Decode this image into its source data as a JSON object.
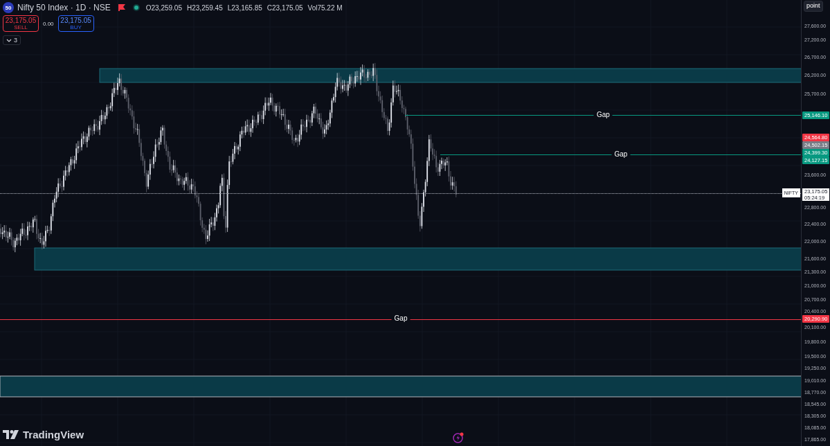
{
  "symbol": {
    "logo_text": "50",
    "title": "Nifty 50 Index · 1D · NSE",
    "flagged": true,
    "market_open": true
  },
  "ohlc": [
    {
      "label": "O",
      "value": "23,259.05"
    },
    {
      "label": "H",
      "value": "23,259.45"
    },
    {
      "label": "L",
      "value": "23,165.85"
    },
    {
      "label": "C",
      "value": "23,175.05"
    },
    {
      "label": "Vol",
      "value": "75.22 M"
    }
  ],
  "trade": {
    "sell": {
      "price": "23,175.05",
      "label": "SELL"
    },
    "spread": "0.00",
    "buy": {
      "price": "23,175.05",
      "label": "BUY"
    }
  },
  "indicators_toggle": {
    "count": "3",
    "expanded": false
  },
  "scale_button": "point",
  "axis_ticks": [
    "27,600.00",
    "27,200.00",
    "26,700.00",
    "26,200.00",
    "25,700.00",
    "23,600.00",
    "22,800.00",
    "22,400.00",
    "22,000.00",
    "21,600.00",
    "21,300.00",
    "21,000.00",
    "20,700.00",
    "20,400.00",
    "20,100.00",
    "19,800.00",
    "19,500.00",
    "19,250.00",
    "19,010.00",
    "18,770.00",
    "18,545.00",
    "18,305.00",
    "18,085.00",
    "17,865.00"
  ],
  "price_labels": [
    {
      "value": "25,146.10",
      "color": "#089981",
      "gap_label": "Gap"
    },
    {
      "value": "24,564.80",
      "color": "#f23645"
    },
    {
      "value": "24,502.15",
      "color": "#787b86"
    },
    {
      "value": "24,399.30",
      "color": "#089981"
    },
    {
      "value": "24,127.15",
      "color": "#089981",
      "gap_label": "Gap"
    },
    {
      "value": "20,290.90",
      "color": "#f23645",
      "gap_label": "Gap"
    }
  ],
  "last_price": {
    "symbol": "NIFTY",
    "price": "23,175.05",
    "countdown": "05:24:19"
  },
  "brand": "TradingView"
}
